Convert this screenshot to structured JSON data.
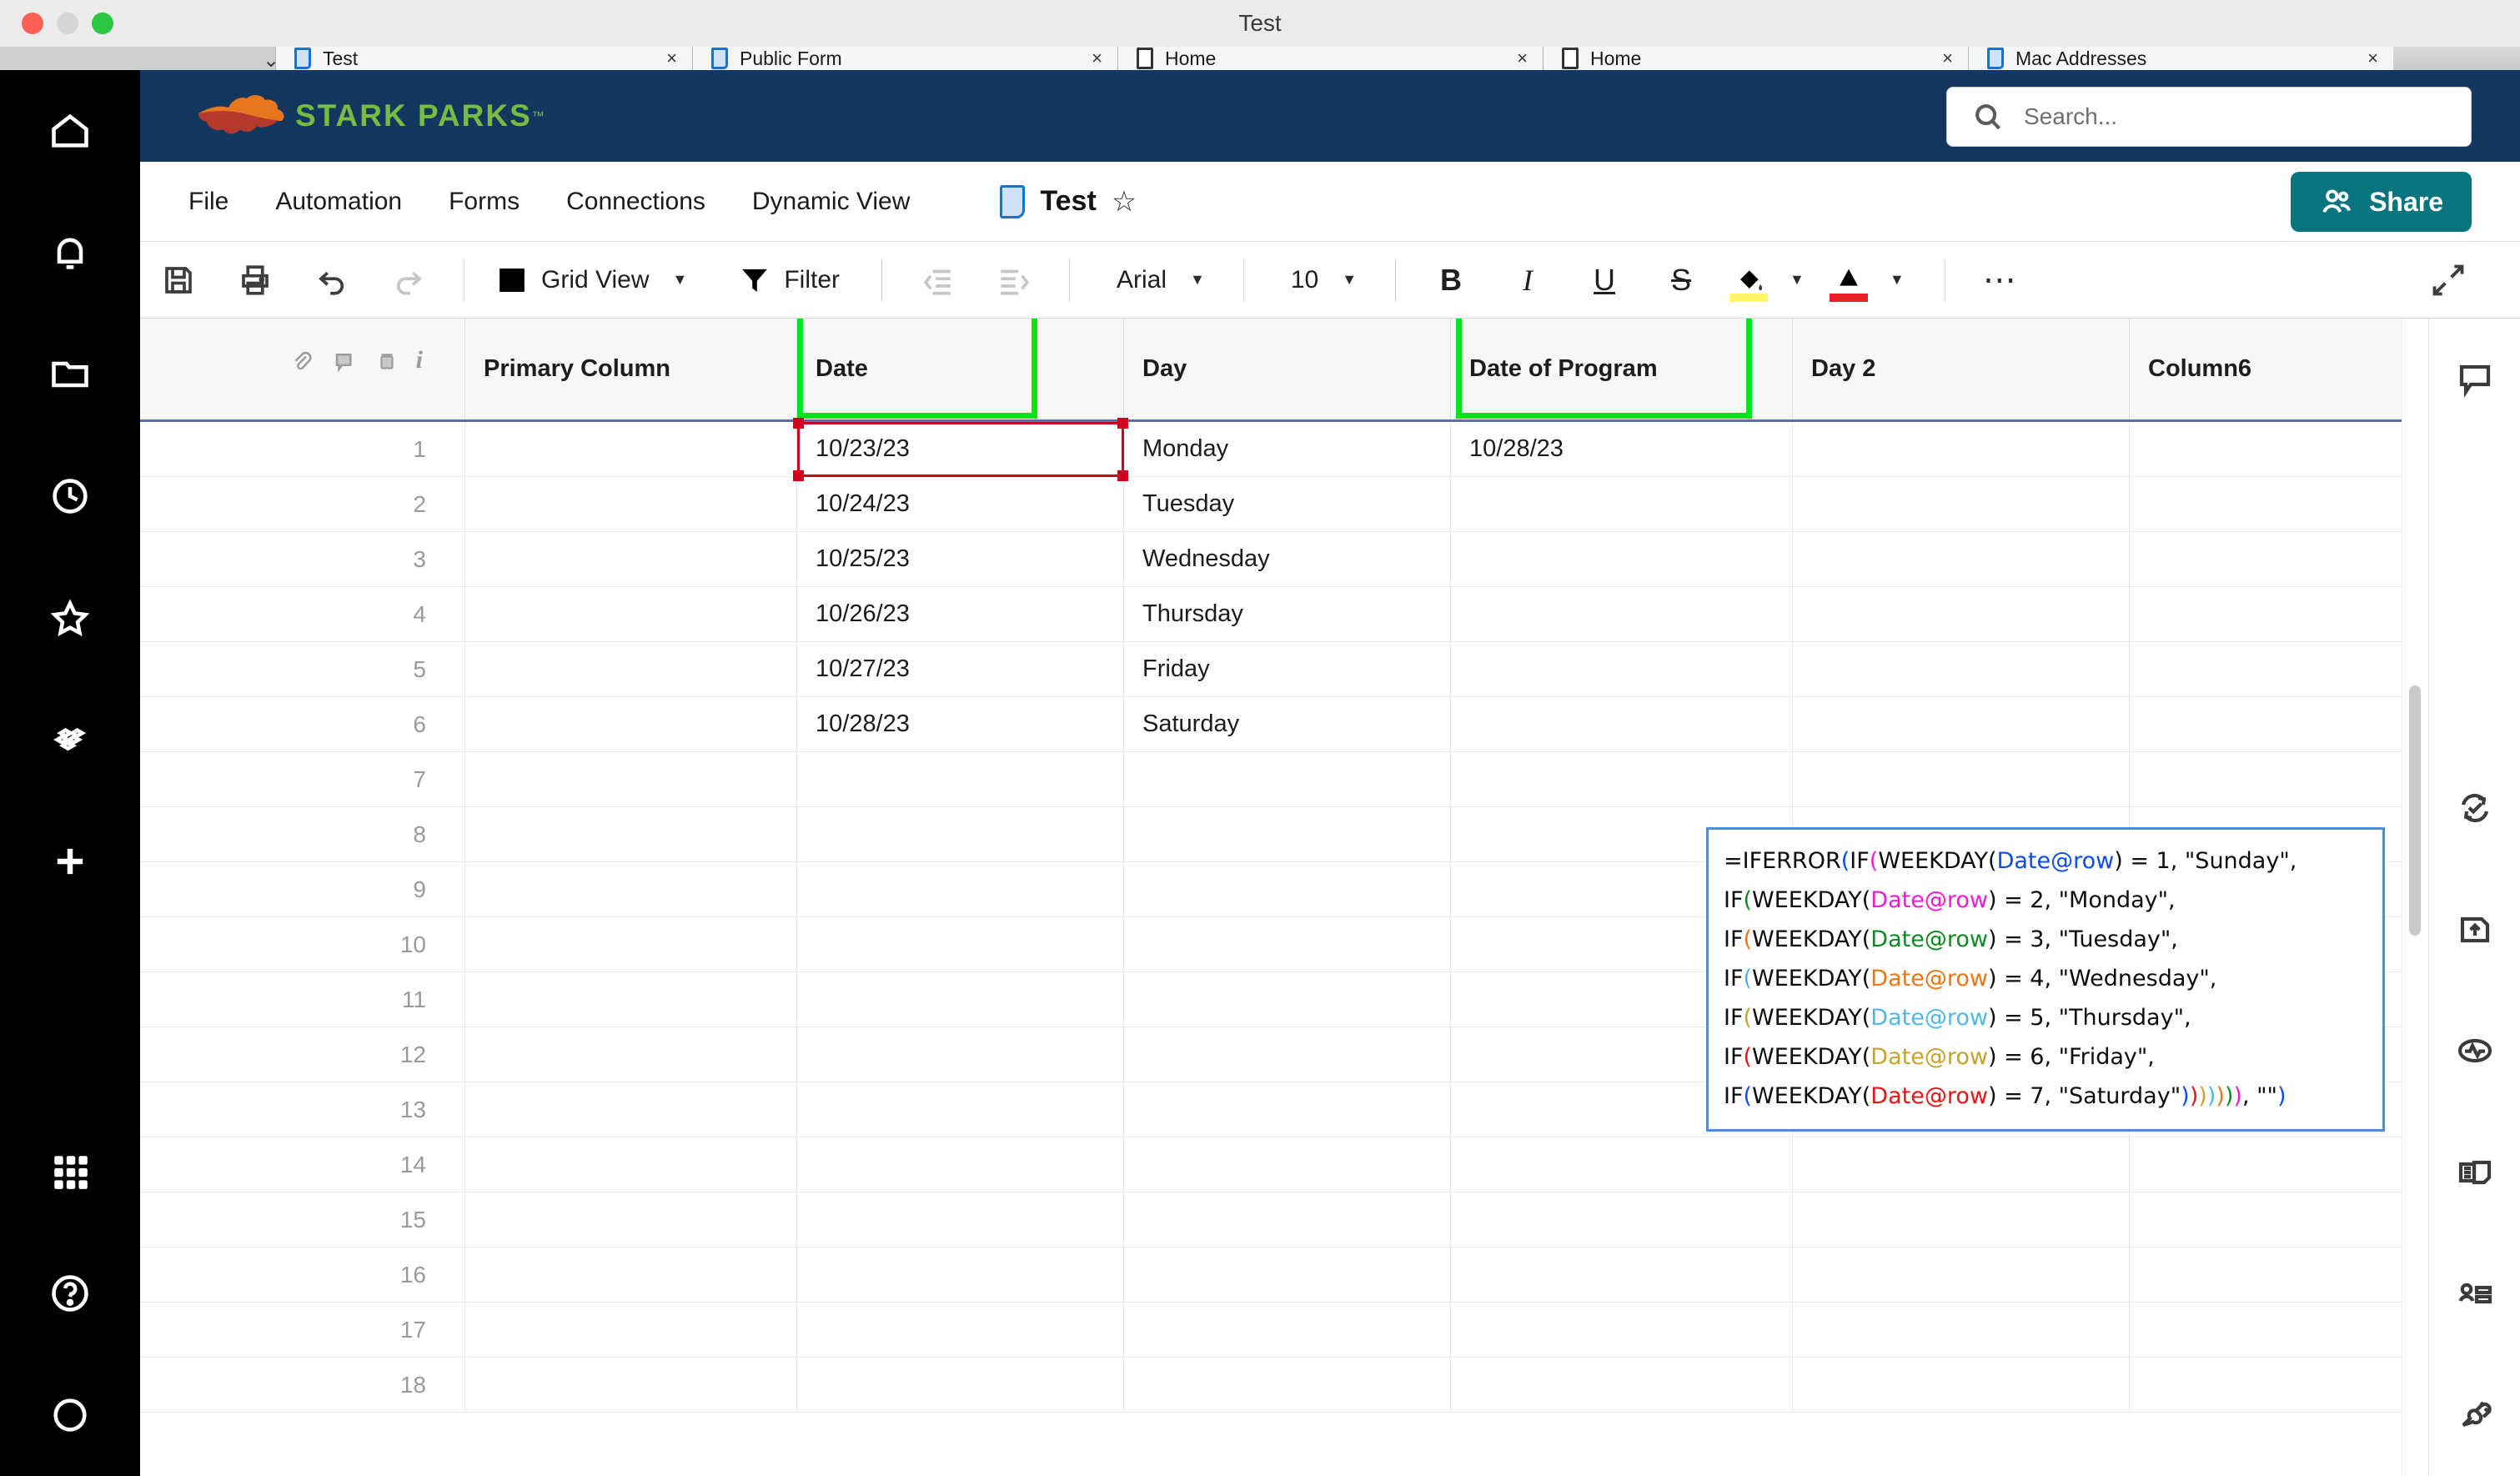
{
  "os": {
    "window_title": "Test",
    "traffic_lights": [
      "close-red",
      "minimize-gray",
      "maximize-green"
    ]
  },
  "browser_tabs": [
    {
      "label": "Test",
      "icon": "sheet-icon",
      "close": "×",
      "active": true
    },
    {
      "label": "Public Form",
      "icon": "sheet-icon",
      "close": "×",
      "active": false
    },
    {
      "label": "Home",
      "icon": "page-icon",
      "close": "×",
      "active": false
    },
    {
      "label": "Home",
      "icon": "page-icon",
      "close": "×",
      "active": false
    },
    {
      "label": "Mac Addresses",
      "icon": "sheet-icon",
      "close": "×",
      "active": false
    }
  ],
  "left_rail": {
    "items": [
      {
        "name": "home-icon"
      },
      {
        "name": "notifications-bell-icon"
      },
      {
        "name": "browse-folder-icon"
      },
      {
        "name": "recents-clock-icon"
      },
      {
        "name": "favorites-star-icon"
      },
      {
        "name": "workapps-diamond-icon"
      },
      {
        "name": "create-plus-icon"
      }
    ],
    "bottom_items": [
      {
        "name": "app-grid-icon"
      },
      {
        "name": "help-question-icon"
      },
      {
        "name": "account-avatar-icon"
      }
    ]
  },
  "brand": {
    "wordmark": "STARK PARKS",
    "trademark": "™",
    "bg_color": "#14375f",
    "wordmark_color": "#76bc43",
    "leaf_colors": [
      "#e8761f",
      "#b5392c"
    ]
  },
  "search": {
    "placeholder": "Search...",
    "icon": "search-icon"
  },
  "menu": {
    "items": [
      "File",
      "Automation",
      "Forms",
      "Connections",
      "Dynamic View"
    ],
    "sheet_title": "Test",
    "sheet_icon": "sheet-icon",
    "favorite_icon": "star-outline-icon",
    "share_label": "Share",
    "share_icon": "people-icon",
    "share_color": "#09757f"
  },
  "toolbar": {
    "save_icon": "save-floppy-icon",
    "print_icon": "printer-icon",
    "undo_icon": "undo-arrow-icon",
    "redo_icon": "redo-arrow-icon",
    "view_label": "Grid View",
    "view_icon": "grid-table-icon",
    "filter_label": "Filter",
    "filter_icon": "funnel-icon",
    "outdent_icon": "outdent-icon",
    "indent_icon": "indent-icon",
    "font_family": "Arial",
    "font_size": "10",
    "bold_label": "B",
    "italic_label": "I",
    "underline_label": "U",
    "strike_label": "S",
    "fill_color_icon": "fill-bucket-icon",
    "fill_swatch": "#fff462",
    "text_color_icon": "text-color-a-icon",
    "text_swatch": "#e8202a",
    "more_icon": "more-ellipsis-icon",
    "expand_icon": "expand-diagonal-icon"
  },
  "grid": {
    "system_icons": [
      "attachment-icon",
      "comment-icon",
      "proof-icon",
      "info-icon"
    ],
    "columns": [
      {
        "id": "rownum",
        "label": ""
      },
      {
        "id": "primary",
        "label": "Primary Column"
      },
      {
        "id": "date",
        "label": "Date",
        "highlight": true
      },
      {
        "id": "day",
        "label": "Day"
      },
      {
        "id": "date_of_program",
        "label": "Date of Program",
        "highlight": true
      },
      {
        "id": "day2",
        "label": "Day 2"
      },
      {
        "id": "column6",
        "label": "Column6"
      }
    ],
    "highlight_color": "#00e519",
    "selected_cell": {
      "row": 1,
      "column": "date",
      "value": "10/23/23",
      "border_color": "#d0021b"
    },
    "rows": [
      {
        "n": "1",
        "primary": "",
        "date": "10/23/23",
        "day": "Monday",
        "date_of_program": "10/28/23",
        "day2": "",
        "column6": ""
      },
      {
        "n": "2",
        "primary": "",
        "date": "10/24/23",
        "day": "Tuesday",
        "date_of_program": "",
        "day2": "",
        "column6": ""
      },
      {
        "n": "3",
        "primary": "",
        "date": "10/25/23",
        "day": "Wednesday",
        "date_of_program": "",
        "day2": "",
        "column6": ""
      },
      {
        "n": "4",
        "primary": "",
        "date": "10/26/23",
        "day": "Thursday",
        "date_of_program": "",
        "day2": "",
        "column6": ""
      },
      {
        "n": "5",
        "primary": "",
        "date": "10/27/23",
        "day": "Friday",
        "date_of_program": "",
        "day2": "",
        "column6": ""
      },
      {
        "n": "6",
        "primary": "",
        "date": "10/28/23",
        "day": "Saturday",
        "date_of_program": "",
        "day2": "",
        "column6": ""
      },
      {
        "n": "7",
        "primary": "",
        "date": "",
        "day": "",
        "date_of_program": "",
        "day2": "",
        "column6": ""
      },
      {
        "n": "8",
        "primary": "",
        "date": "",
        "day": "",
        "date_of_program": "",
        "day2": "",
        "column6": ""
      },
      {
        "n": "9",
        "primary": "",
        "date": "",
        "day": "",
        "date_of_program": "",
        "day2": "",
        "column6": ""
      },
      {
        "n": "10",
        "primary": "",
        "date": "",
        "day": "",
        "date_of_program": "",
        "day2": "",
        "column6": ""
      },
      {
        "n": "11",
        "primary": "",
        "date": "",
        "day": "",
        "date_of_program": "",
        "day2": "",
        "column6": ""
      },
      {
        "n": "12",
        "primary": "",
        "date": "",
        "day": "",
        "date_of_program": "",
        "day2": "",
        "column6": ""
      },
      {
        "n": "13",
        "primary": "",
        "date": "",
        "day": "",
        "date_of_program": "",
        "day2": "",
        "column6": ""
      },
      {
        "n": "14",
        "primary": "",
        "date": "",
        "day": "",
        "date_of_program": "",
        "day2": "",
        "column6": ""
      },
      {
        "n": "15",
        "primary": "",
        "date": "",
        "day": "",
        "date_of_program": "",
        "day2": "",
        "column6": ""
      },
      {
        "n": "16",
        "primary": "",
        "date": "",
        "day": "",
        "date_of_program": "",
        "day2": "",
        "column6": ""
      },
      {
        "n": "17",
        "primary": "",
        "date": "",
        "day": "",
        "date_of_program": "",
        "day2": "",
        "column6": ""
      },
      {
        "n": "18",
        "primary": "",
        "date": "",
        "day": "",
        "date_of_program": "",
        "day2": "",
        "column6": ""
      }
    ]
  },
  "formula_editor": {
    "full_text": "=IFERROR(IF(WEEKDAY(Date@row) = 1, \"Sunday\", IF(WEEKDAY(Date@row) = 2, \"Monday\", IF(WEEKDAY(Date@row) = 3, \"Tuesday\", IF(WEEKDAY(Date@row) = 4, \"Wednesday\", IF(WEEKDAY(Date@row) = 5, \"Thursday\", IF(WEEKDAY(Date@row) = 6, \"Friday\", IF(WEEKDAY(Date@row) = 7, \"Saturday\")))))), \"\")",
    "border_color": "#4a90d9",
    "token_colors": {
      "level1": "#0b4bf0",
      "level2": "#f716dd",
      "level3": "#0a8c20",
      "level4": "#f07511",
      "level5": "#4fb7e8",
      "level6": "#c9a227",
      "level7": "#ef1111"
    }
  },
  "right_rail": {
    "items": [
      {
        "name": "conversations-comment-icon"
      },
      {
        "name": "update-request-icon"
      },
      {
        "name": "publish-upload-icon"
      },
      {
        "name": "activity-log-icon"
      },
      {
        "name": "proofs-icon"
      },
      {
        "name": "contacts-icon"
      },
      {
        "name": "connections-plug-icon"
      }
    ]
  }
}
